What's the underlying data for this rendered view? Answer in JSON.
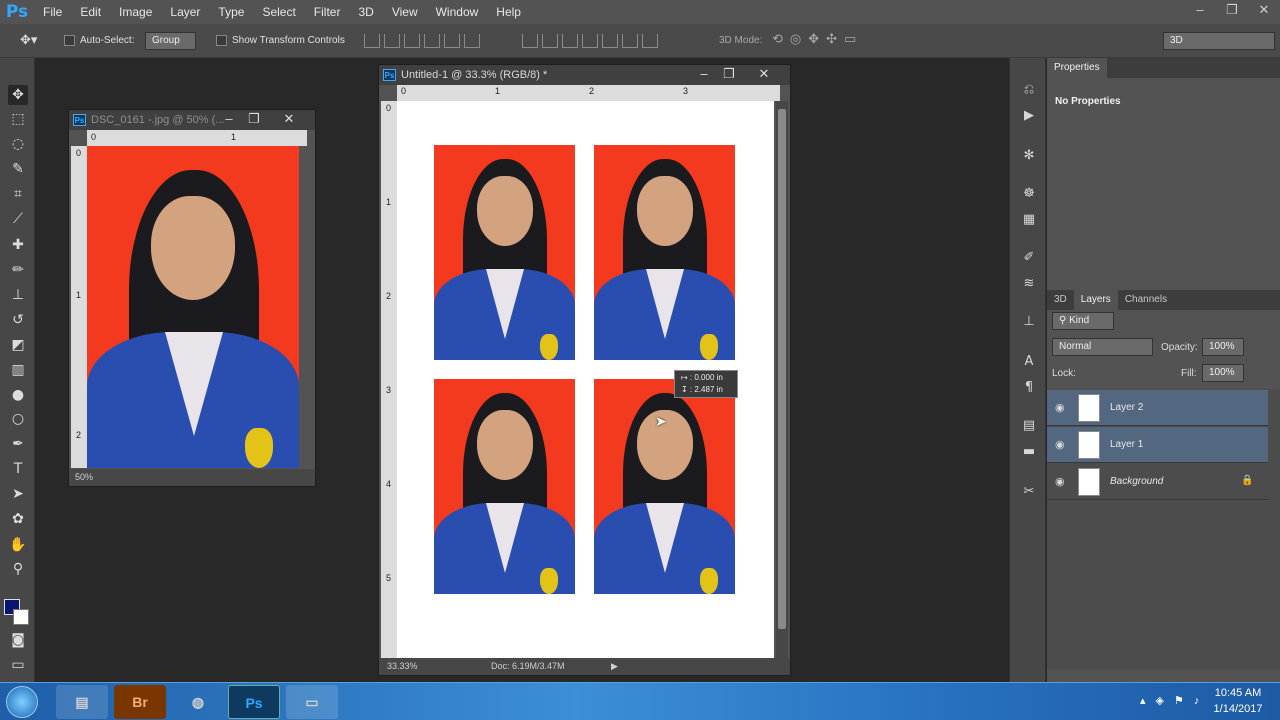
{
  "app": {
    "logo": "Ps",
    "menu": [
      "File",
      "Edit",
      "Image",
      "Layer",
      "Type",
      "Select",
      "Filter",
      "3D",
      "View",
      "Window",
      "Help"
    ]
  },
  "options": {
    "auto_select": "Auto-Select:",
    "group": "Group",
    "show_transform": "Show Transform Controls",
    "mode_label": "3D Mode:",
    "workspace": "3D"
  },
  "doc1": {
    "title": "DSC_0161 -.jpg @ 50% (...",
    "zoom": "50%",
    "ruler_h": [
      "0",
      "1"
    ],
    "ruler_v": [
      "0",
      "1",
      "2"
    ]
  },
  "doc2": {
    "title": "Untitled-1 @ 33.3% (RGB/8) *",
    "zoom": "33.33%",
    "doc_size": "Doc: 6.19M/3.47M",
    "ruler_h": [
      "0",
      "1",
      "2",
      "3"
    ],
    "ruler_v": [
      "0",
      "1",
      "2",
      "3",
      "4",
      "5"
    ]
  },
  "tooltip": {
    "line1": "↦ :  0.000 in",
    "line2": "↧ :  2.487 in"
  },
  "properties": {
    "tab": "Properties",
    "content": "No Properties"
  },
  "layers_panel": {
    "tabs": [
      "3D",
      "Layers",
      "Channels"
    ],
    "kind": "Kind",
    "blend": "Normal",
    "opacity_label": "Opacity:",
    "opacity": "100%",
    "lock_label": "Lock:",
    "fill_label": "Fill:",
    "fill": "100%",
    "layers": [
      {
        "name": "Layer 2",
        "selected": true
      },
      {
        "name": "Layer 1",
        "selected": true
      },
      {
        "name": "Background",
        "selected": false
      }
    ]
  },
  "taskbar": {
    "time": "10:45 AM",
    "date": "1/14/2017",
    "bridge": "Br",
    "photoshop": "Ps"
  },
  "colors": {
    "accent": "#31a8ff",
    "photo_bg": "#f33a1e",
    "jacket": "#2a4eb0",
    "selected_layer": "#536780"
  }
}
